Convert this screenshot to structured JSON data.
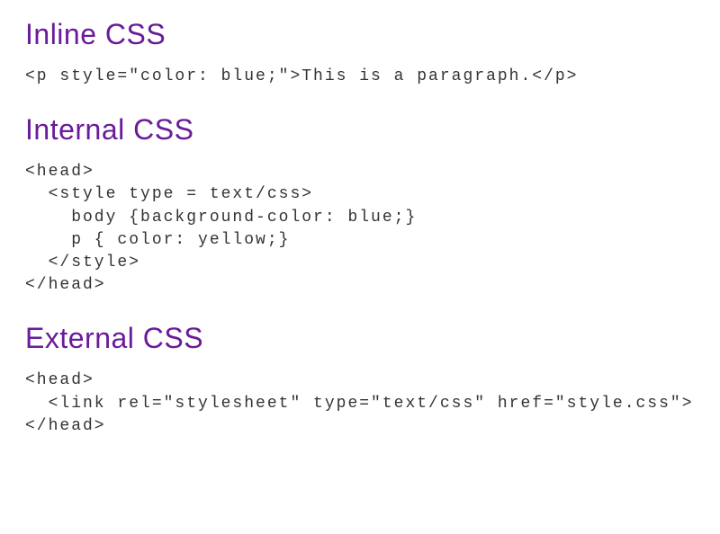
{
  "sections": [
    {
      "heading": "Inline CSS",
      "code": "<p style=\"color: blue;\">This is a paragraph.</p>"
    },
    {
      "heading": "Internal CSS",
      "code": "<head>\n  <style type = text/css>\n    body {background-color: blue;}\n    p { color: yellow;}\n  </style>\n</head>"
    },
    {
      "heading": "External CSS",
      "code": "<head>\n  <link rel=\"stylesheet\" type=\"text/css\" href=\"style.css\">\n</head>"
    }
  ]
}
